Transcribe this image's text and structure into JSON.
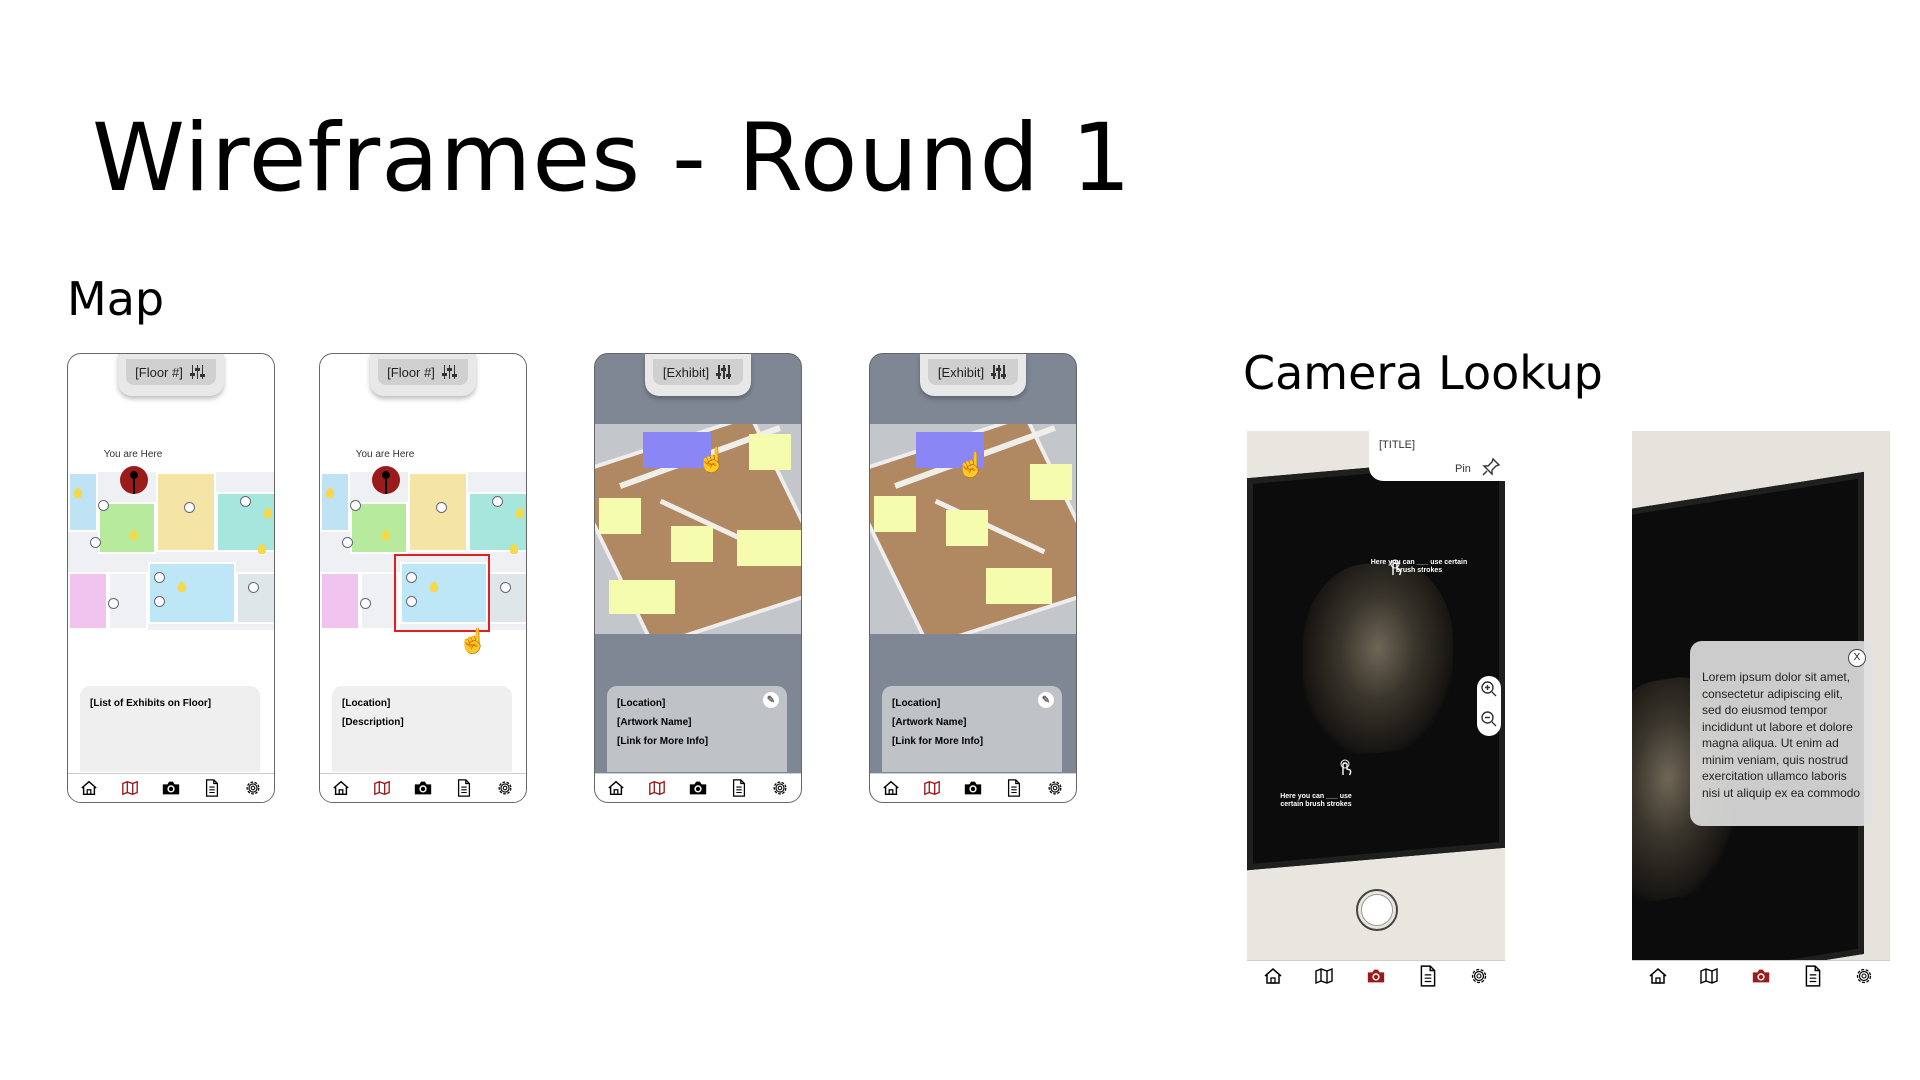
{
  "slide": {
    "title": "Wireframes - Round 1",
    "map_heading": "Map",
    "camera_heading": "Camera Lookup"
  },
  "map_screens": [
    {
      "header": "[Floor #]",
      "you_are_here": "You are Here",
      "sheet_lines": [
        "[List of Exhibits on Floor]"
      ]
    },
    {
      "header": "[Floor #]",
      "you_are_here": "You are Here",
      "sheet_lines": [
        "[Location]",
        "[Description]"
      ]
    },
    {
      "header": "[Exhibit]",
      "sheet_lines": [
        "[Location]",
        "[Artwork Name]",
        "[Link for More Info]"
      ]
    },
    {
      "header": "[Exhibit]",
      "sheet_lines": [
        "[Location]",
        "[Artwork Name]",
        "[Link for More Info]"
      ]
    }
  ],
  "camera_screens": {
    "first": {
      "title": "[TITLE]",
      "pin_label": "Pin",
      "hint_top": "Here you can ___ use certain brush strokes",
      "hint_bottom": "Here you can ___ use certain brush strokes"
    },
    "second": {
      "popup_text": "Lorem ipsum dolor sit amet, consectetur adipiscing elit, sed do eiusmod tempor incididunt ut labore et dolore magna aliqua. Ut enim ad minim veniam, quis nostrud exercitation ullamco laboris nisi ut aliquip ex ea commodo",
      "close_label": "X"
    }
  },
  "tab_icons": [
    "home-icon",
    "map-icon",
    "camera-icon",
    "document-icon",
    "gear-icon"
  ],
  "colors": {
    "accent": "#9b1b1b",
    "sticky": "#f6fcae",
    "selection": "#8a86f5",
    "highlight": "#e02020"
  }
}
